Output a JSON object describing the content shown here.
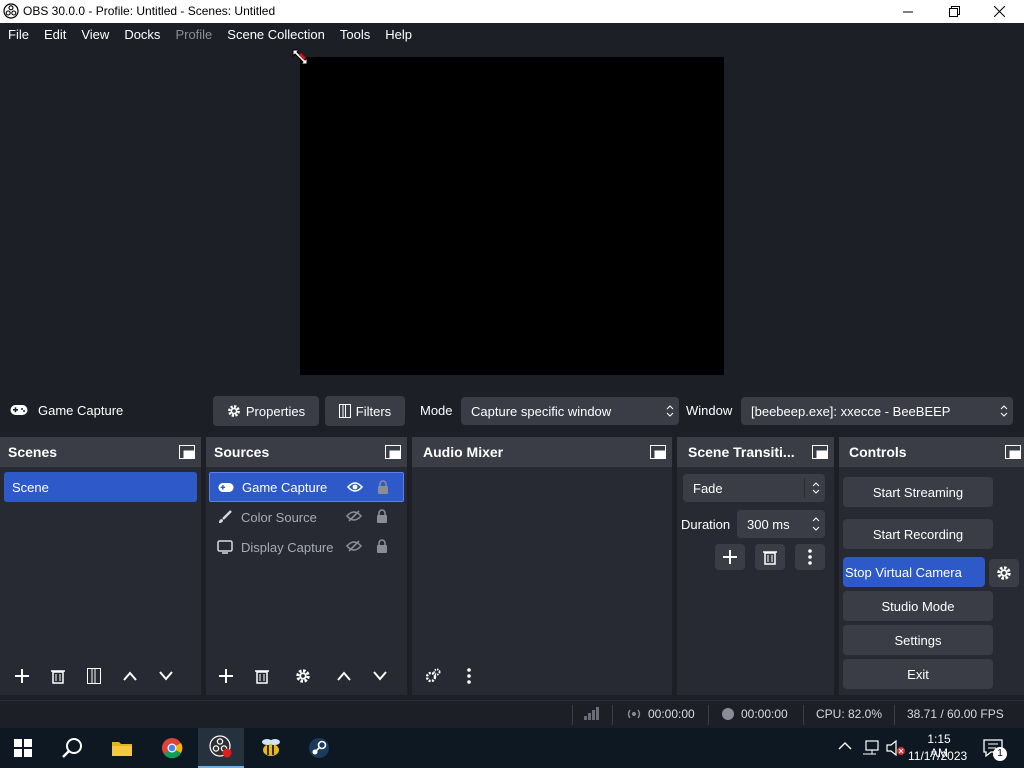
{
  "window": {
    "title": "OBS 30.0.0 - Profile: Untitled - Scenes: Untitled"
  },
  "menu": [
    "File",
    "Edit",
    "View",
    "Docks",
    "Profile",
    "Scene Collection",
    "Tools",
    "Help"
  ],
  "menu_disabled": [
    "Profile"
  ],
  "source_toolbar": {
    "source_name": "Game Capture",
    "properties_label": "Properties",
    "filters_label": "Filters",
    "mode_label": "Mode",
    "mode_value": "Capture specific window",
    "window_label": "Window",
    "window_value": "[beebeep.exe]: xxecce - BeeBEEP"
  },
  "scenes": {
    "title": "Scenes",
    "items": [
      {
        "label": "Scene",
        "selected": true
      }
    ]
  },
  "sources": {
    "title": "Sources",
    "items": [
      {
        "label": "Game Capture",
        "icon": "gamepad-icon",
        "visible": true,
        "selected": true
      },
      {
        "label": "Color Source",
        "icon": "brush-icon",
        "visible": false,
        "selected": false
      },
      {
        "label": "Display Capture",
        "icon": "monitor-icon",
        "visible": false,
        "selected": false
      }
    ]
  },
  "audio_mixer": {
    "title": "Audio Mixer"
  },
  "transitions": {
    "title": "Scene Transiti...",
    "transition_value": "Fade",
    "duration_label": "Duration",
    "duration_value": "300 ms"
  },
  "controls": {
    "title": "Controls",
    "start_streaming": "Start Streaming",
    "start_recording": "Start Recording",
    "virtual_camera": "Stop Virtual Camera",
    "studio_mode": "Studio Mode",
    "settings": "Settings",
    "exit": "Exit"
  },
  "status": {
    "stream_time": "00:00:00",
    "record_time": "00:00:00",
    "cpu": "CPU: 82.0%",
    "fps": "38.71 / 60.00 FPS"
  },
  "taskbar": {
    "time": "1:15 AM",
    "date": "11/17/2023",
    "notification_count": "1"
  },
  "colors": {
    "accent": "#2d5ac8",
    "dock_bg": "#272a33",
    "header_bg": "#3a3d46",
    "window_bg": "#1d1f26"
  }
}
